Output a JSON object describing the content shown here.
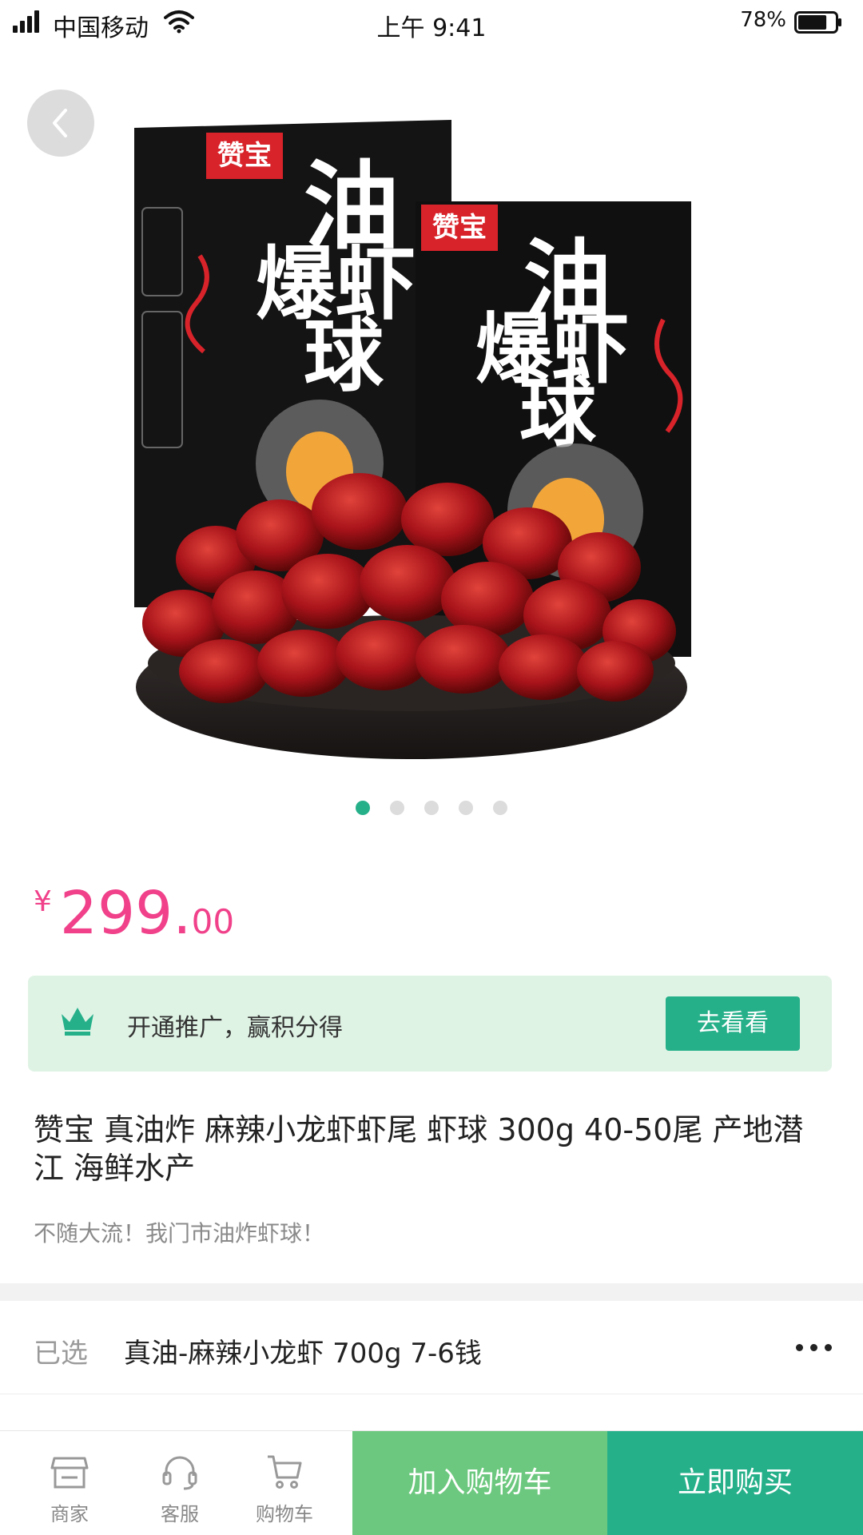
{
  "status_bar": {
    "carrier": "中国移动",
    "time": "上午 9:41",
    "battery": "78%",
    "battery_level": 0.78
  },
  "hero": {
    "carousel_count": 5,
    "carousel_active_index": 0
  },
  "price": {
    "currency": "¥",
    "integer": "299.",
    "decimal": "00"
  },
  "promo": {
    "text": "开通推广，赢积分得",
    "button": "去看看"
  },
  "product": {
    "title": "赞宝 真油炸 麻辣小龙虾虾尾 虾球 300g 40-50尾 产地潜江 海鲜水产",
    "subtitle": "不随大流！我门市油炸虾球！"
  },
  "spec": {
    "label": "已选",
    "value": "真油-麻辣小龙虾 700g 7-6钱"
  },
  "bottom_bar": {
    "tabs": [
      {
        "label": "商家",
        "icon": "store-icon"
      },
      {
        "label": "客服",
        "icon": "headset-icon"
      },
      {
        "label": "购物车",
        "icon": "cart-icon"
      }
    ],
    "add_to_cart": "加入购物车",
    "buy_now": "立即购买"
  },
  "colors": {
    "accent": "#26b08a",
    "price": "#f0418a",
    "cart_button": "#6cc87e",
    "promo_bg": "#dff3e5"
  }
}
